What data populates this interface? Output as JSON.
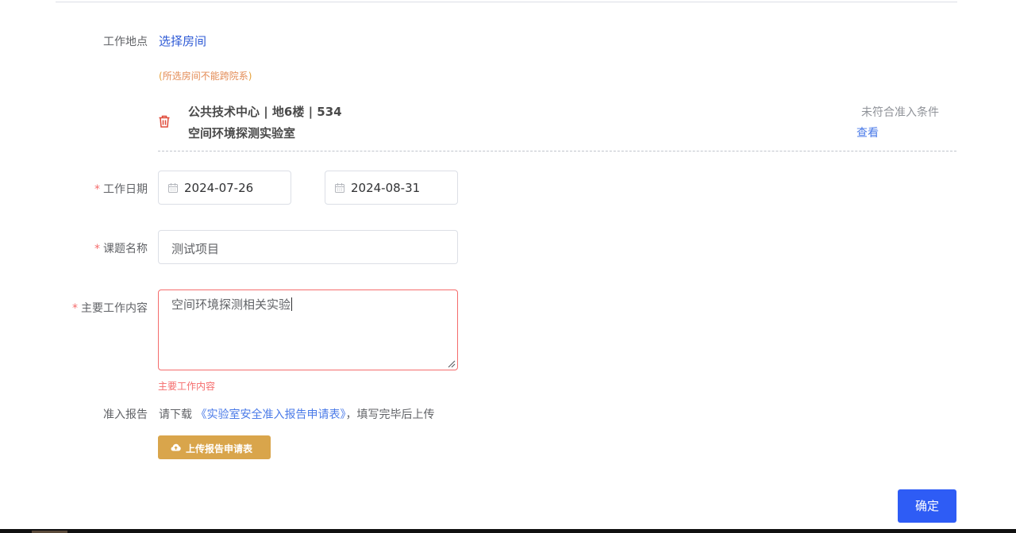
{
  "form": {
    "location_label": "工作地点",
    "select_room_label": "选择房间",
    "hint_open": "(",
    "hint_text": "所选房间不能跨院系",
    "hint_close": ")",
    "room": {
      "line1": "公共技术中心 | 地6楼 | 534",
      "line2": "空间环境探测实验室",
      "status": "未符合准入条件",
      "view_label": "查看"
    },
    "date_label": "工作日期",
    "date_start": "2024-07-26",
    "date_end": "2024-08-31",
    "topic_label": "课题名称",
    "topic_value": "测试项目",
    "content_label": "主要工作内容",
    "content_value": "空间环境探测相关实验",
    "content_error": "主要工作内容",
    "report_label": "准入报告",
    "report_prefix": "请下载",
    "report_link": "《实验室安全准入报告申请表》",
    "report_suffix": "，填写完毕后上传",
    "upload_button": "上传报告申请表",
    "required_mark": "*",
    "confirm_button": "确定"
  },
  "colors": {
    "primary": "#2e5cf5",
    "link": "#4a7ae8",
    "error": "#f56c6c",
    "upload": "#d9a54b",
    "trash": "#e04b3a"
  },
  "icons": {
    "trash": "trash-icon",
    "calendar": "calendar-icon",
    "cloud_upload": "cloud-upload-icon",
    "resize": "resize-handle-icon"
  }
}
